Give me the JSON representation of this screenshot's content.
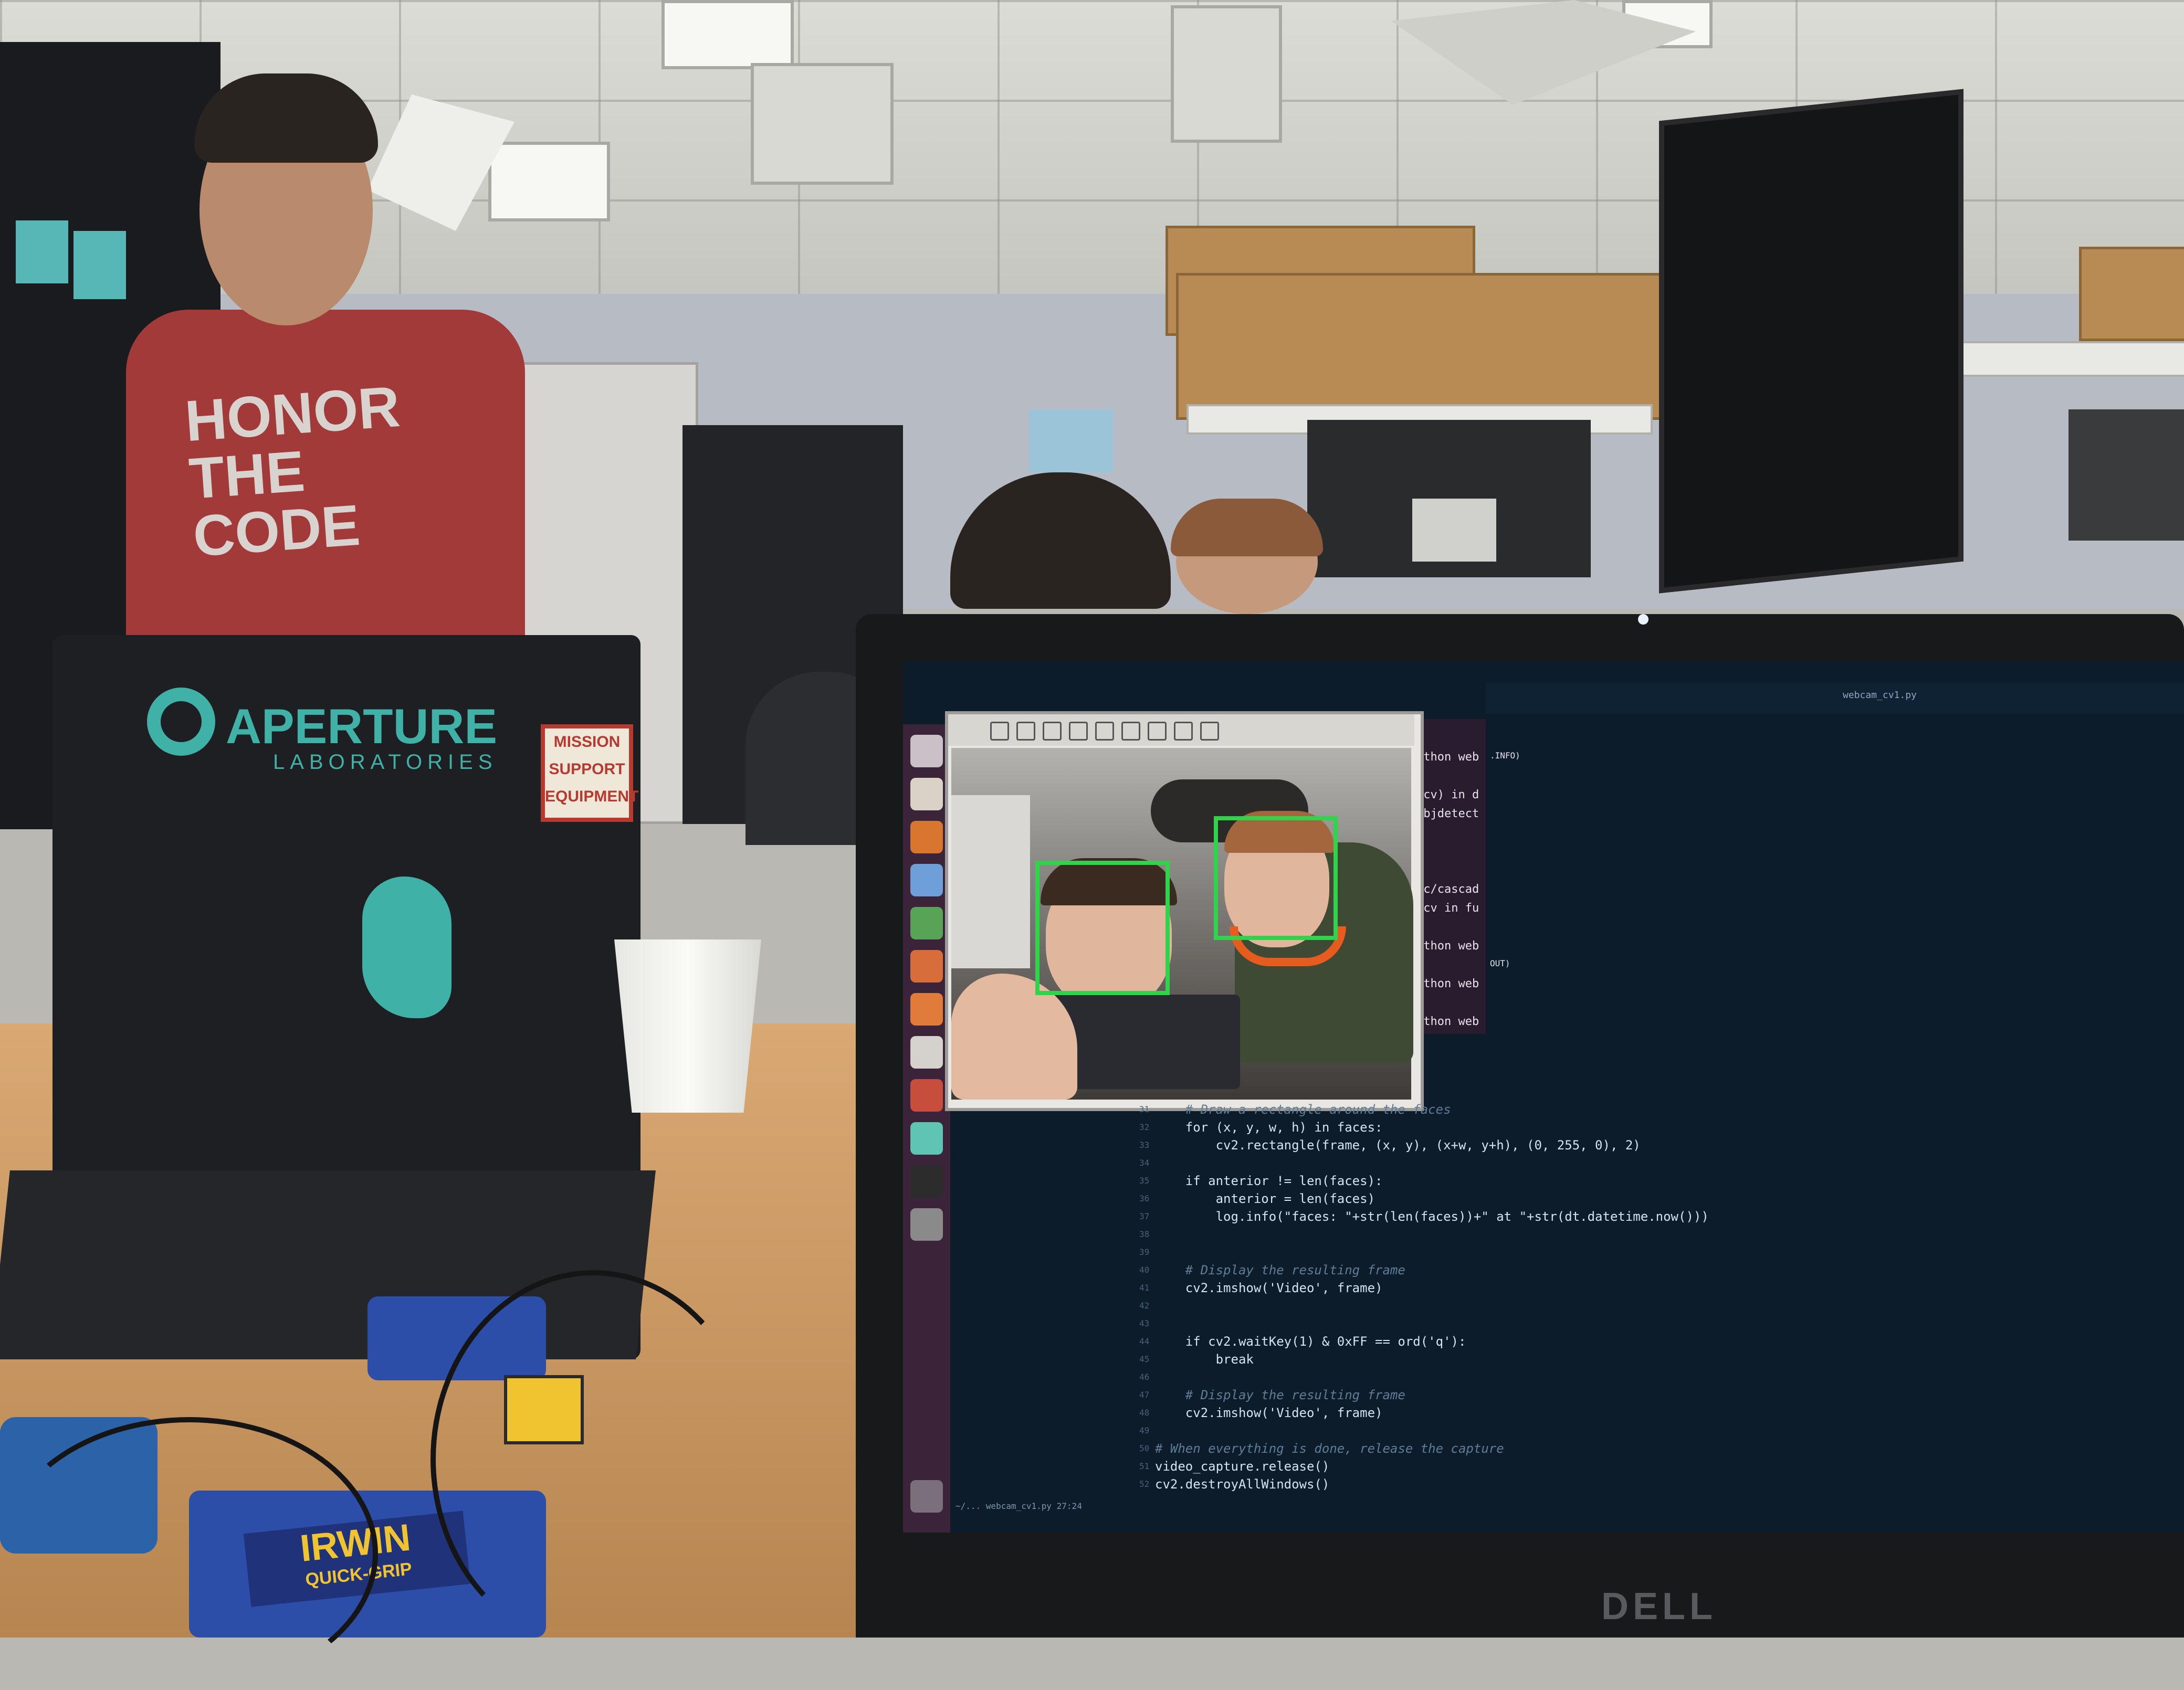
{
  "scene": {
    "description_hint": "",
    "shirt_text": "HONOR THE CODE",
    "left_laptop": {
      "brand_line1": "APERTURE",
      "brand_line2": "LABORATORIES",
      "sticker_lines": [
        "MISSION",
        "SUPPORT",
        "EQUIPMENT"
      ]
    },
    "clamp_label": {
      "brand": "IRWIN",
      "model": "QUICK-GRIP"
    },
    "laptop_brand": "DELL"
  },
  "screen": {
    "editor_tab": "webcam_cv1.py",
    "status_bar": "~/... webcam_cv1.py   27:24",
    "terminal_lines": [
      "ython web",
      "",
      "_cv) in d",
      "objdetect",
      "",
      "",
      "",
      "rc/cascad",
      "_cv in fu",
      "",
      "ython web",
      "",
      "ython web",
      "",
      "ython web"
    ],
    "terminal_side": [
      ".INFO)",
      "",
      "",
      "",
      "",
      "",
      "",
      "",
      "",
      "",
      "",
      "OUT)"
    ],
    "code_lines": [
      {
        "text": "    # Draw a rectangle around the faces",
        "comment": true
      },
      {
        "text": "    for (x, y, w, h) in faces:",
        "comment": false
      },
      {
        "text": "        cv2.rectangle(frame, (x, y), (x+w, y+h), (0, 255, 0), 2)",
        "comment": false
      },
      {
        "text": "",
        "comment": false
      },
      {
        "text": "    if anterior != len(faces):",
        "comment": false
      },
      {
        "text": "        anterior = len(faces)",
        "comment": false
      },
      {
        "text": "        log.info(\"faces: \"+str(len(faces))+\" at \"+str(dt.datetime.now()))",
        "comment": false
      },
      {
        "text": "",
        "comment": false
      },
      {
        "text": "",
        "comment": false
      },
      {
        "text": "    # Display the resulting frame",
        "comment": true
      },
      {
        "text": "    cv2.imshow('Video', frame)",
        "comment": false
      },
      {
        "text": "",
        "comment": false
      },
      {
        "text": "",
        "comment": false
      },
      {
        "text": "    if cv2.waitKey(1) & 0xFF == ord('q'):",
        "comment": false
      },
      {
        "text": "        break",
        "comment": false
      },
      {
        "text": "",
        "comment": false
      },
      {
        "text": "    # Display the resulting frame",
        "comment": true
      },
      {
        "text": "    cv2.imshow('Video', frame)",
        "comment": false
      },
      {
        "text": "",
        "comment": false
      },
      {
        "text": "# When everything is done, release the capture",
        "comment": true
      },
      {
        "text": "video_capture.release()",
        "comment": false
      },
      {
        "text": "cv2.destroyAllWindows()",
        "comment": false
      }
    ],
    "line_numbers": [
      "31",
      "32",
      "33",
      "34",
      "35",
      "36",
      "37",
      "38",
      "39",
      "40",
      "41",
      "42",
      "43",
      "44",
      "45",
      "46",
      "47",
      "48",
      "49",
      "50",
      "51",
      "52"
    ]
  },
  "colors": {
    "face_box": "#2fd44b",
    "aperture_teal": "#3fb1a7",
    "launcher": "#3b2339",
    "editor_bg": "#0c1c2b"
  },
  "icons": [
    "ubuntu-dash-icon",
    "files-icon",
    "firefox-icon",
    "libreoffice-writer-icon",
    "libreoffice-calc-icon",
    "libreoffice-impress-icon",
    "software-center-icon",
    "amazon-icon",
    "settings-icon",
    "app-icon",
    "terminal-icon",
    "drive-icon",
    "trash-icon"
  ]
}
